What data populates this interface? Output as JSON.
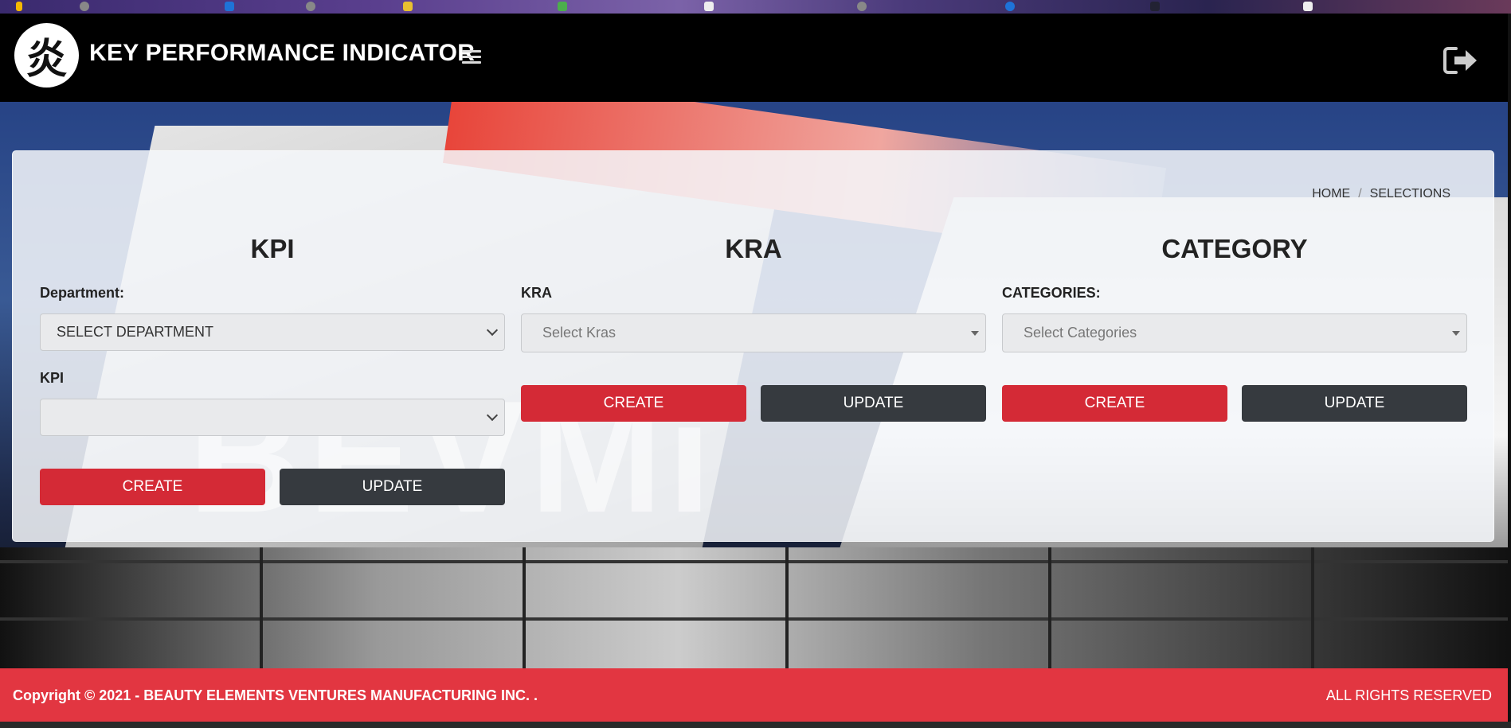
{
  "header": {
    "logo_glyph": "炎",
    "title": "KEY PERFORMANCE INDICATOR",
    "menu_icon": "hamburger-icon",
    "logout_icon": "logout-icon"
  },
  "breadcrumb": {
    "home": "HOME",
    "separator": "/",
    "current": "SELECTIONS"
  },
  "watermark": "BEVMi",
  "kpi": {
    "heading": "KPI",
    "department_label": "Department:",
    "department_value": "SELECT DEPARTMENT",
    "kpi_label": "KPI",
    "kpi_value": "",
    "create_label": "CREATE",
    "update_label": "UPDATE"
  },
  "kra": {
    "heading": "KRA",
    "kra_label": "KRA",
    "kra_placeholder": "Select Kras",
    "create_label": "CREATE",
    "update_label": "UPDATE"
  },
  "category": {
    "heading": "CATEGORY",
    "categories_label": "CATEGORIES:",
    "categories_placeholder": "Select Categories",
    "create_label": "CREATE",
    "update_label": "UPDATE"
  },
  "footer": {
    "copyright": "Copyright © 2021 - BEAUTY ELEMENTS VENTURES MANUFACTURING INC. .",
    "rights": "ALL RIGHTS RESERVED"
  },
  "colors": {
    "brand_red": "#e23641",
    "create_red": "#d42a36",
    "update_dark": "#363a3f",
    "header_bg": "#000000"
  }
}
